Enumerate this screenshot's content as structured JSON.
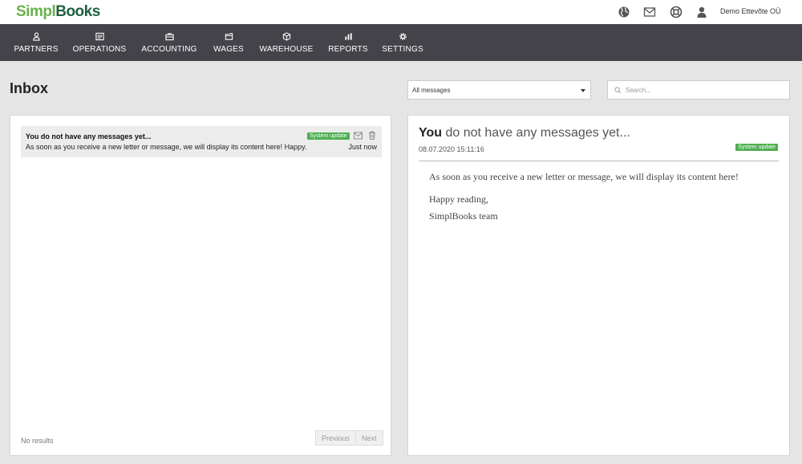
{
  "header": {
    "logo_part1": "Simpl",
    "logo_part2": "Books",
    "company": "Demo Ettevõte OÜ",
    "icons": [
      "globe-icon",
      "mail-icon",
      "lifebuoy-icon",
      "user-icon"
    ]
  },
  "nav": [
    {
      "label": "PARTNERS",
      "icon": "partners-icon"
    },
    {
      "label": "OPERATIONS",
      "icon": "operations-icon"
    },
    {
      "label": "ACCOUNTING",
      "icon": "briefcase-icon"
    },
    {
      "label": "WAGES",
      "icon": "wallet-icon"
    },
    {
      "label": "WAREHOUSE",
      "icon": "boxes-icon"
    },
    {
      "label": "REPORTS",
      "icon": "bar-chart-icon"
    },
    {
      "label": "SETTINGS",
      "icon": "gear-icon"
    }
  ],
  "page": {
    "title": "Inbox",
    "filter_value": "All messages",
    "search_placeholder": "Search..."
  },
  "message_list": {
    "items": [
      {
        "subject": "You do not have any messages yet...",
        "preview": "As soon as you receive a new letter or message, we will display its content here! Happy...",
        "badge": "System update",
        "time": "Just now"
      }
    ],
    "no_results": "No results",
    "pager": {
      "previous": "Previous",
      "next": "Next"
    }
  },
  "detail": {
    "title_first": "You",
    "title_rest": " do not have any messages yet...",
    "date": "08.07.2020 15:11:16",
    "badge": "System update",
    "body": [
      "As soon as you receive a new letter or message, we will display its content here!",
      "Happy reading,",
      "SimplBooks team"
    ]
  },
  "colors": {
    "nav_bg": "#44434a",
    "badge_green": "#4caf50",
    "logo_green": "#6ab04c",
    "logo_dark": "#1f5f3f"
  }
}
